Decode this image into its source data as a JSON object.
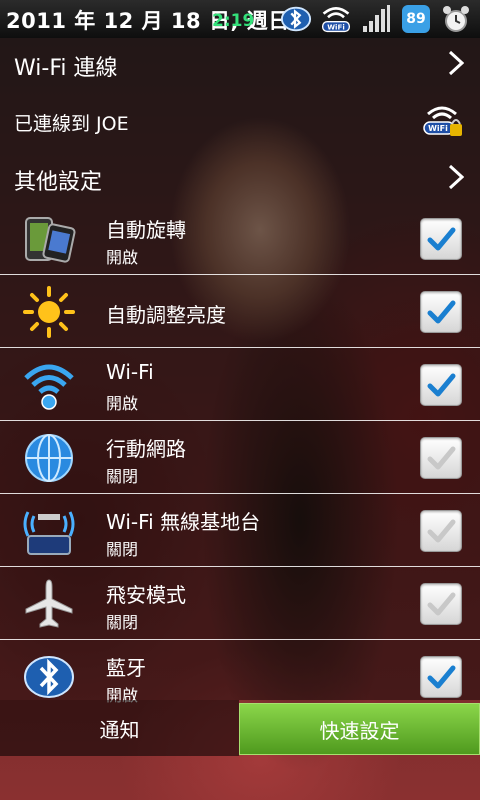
{
  "status_bar": {
    "date_text": "2011 年 12 月 18 日, 週日",
    "time_text": "2:19",
    "battery_level": "89",
    "icons": [
      "bluetooth-icon",
      "wifi-icon",
      "signal-icon",
      "android-battery-icon",
      "alarm-clock-icon"
    ]
  },
  "settings": {
    "wifi_header": "Wi-Fi 連線",
    "connected_text": "已連線到 JOE",
    "other_header": "其他設定"
  },
  "toggles": [
    {
      "title": "自動旋轉",
      "status": "開啟",
      "checked": true,
      "icon": "rotate-phone-icon"
    },
    {
      "title": "自動調整亮度",
      "status": "",
      "checked": true,
      "icon": "sun-brightness-icon"
    },
    {
      "title": "Wi-Fi",
      "status": "開啟",
      "checked": true,
      "icon": "wifi-icon"
    },
    {
      "title": "行動網路",
      "status": "關閉",
      "checked": false,
      "icon": "globe-network-icon"
    },
    {
      "title": "Wi-Fi 無線基地台",
      "status": "關閉",
      "checked": false,
      "icon": "hotspot-icon"
    },
    {
      "title": "飛安模式",
      "status": "關閉",
      "checked": false,
      "icon": "airplane-icon"
    },
    {
      "title": "藍牙",
      "status": "開啟",
      "checked": true,
      "icon": "bluetooth-icon"
    }
  ],
  "tabs": {
    "notify": "通知",
    "quick_settings": "快速設定"
  },
  "colors": {
    "time_green": "#34e07a",
    "check_blue": "#1a7fd0",
    "check_gray": "#c8c8c8",
    "tab_active": "#6cbf34"
  }
}
